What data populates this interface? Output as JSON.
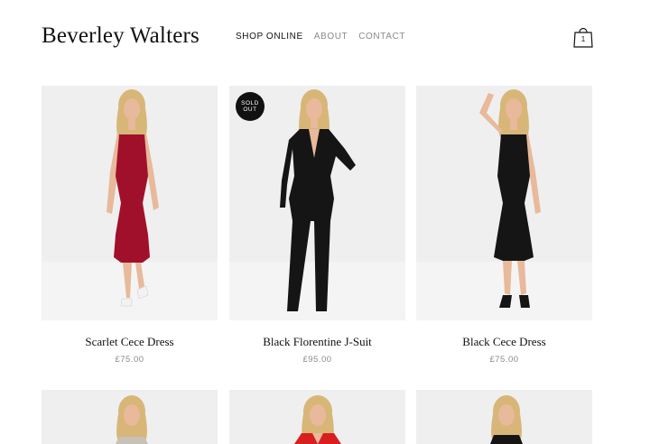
{
  "brand": "Beverley Walters",
  "nav": {
    "items": [
      {
        "label": "SHOP ONLINE",
        "active": true
      },
      {
        "label": "ABOUT",
        "active": false
      },
      {
        "label": "CONTACT",
        "active": false
      }
    ]
  },
  "cart": {
    "count": "1",
    "icon": "shopping-bag-icon"
  },
  "products": [
    {
      "title": "Scarlet Cece Dress",
      "price": "£75.00",
      "dress_color": "#a0102a",
      "sold_out": false
    },
    {
      "title": "Black Florentine J-Suit",
      "price": "£95.00",
      "dress_color": "#151515",
      "sold_out": true,
      "badge_line1": "SOLD",
      "badge_line2": "OUT"
    },
    {
      "title": "Black Cece Dress",
      "price": "£75.00",
      "dress_color": "#151515",
      "sold_out": false
    }
  ],
  "next_row": [
    {
      "dress_color": "#c9c0b8"
    },
    {
      "dress_color": "#d81f1f"
    },
    {
      "dress_color": "#151515"
    }
  ],
  "colors": {
    "text": "#111111",
    "muted": "#8a8a8a",
    "photo_bg": "#efefef",
    "skin": "#e8b99a",
    "hair": "#d7b678"
  }
}
